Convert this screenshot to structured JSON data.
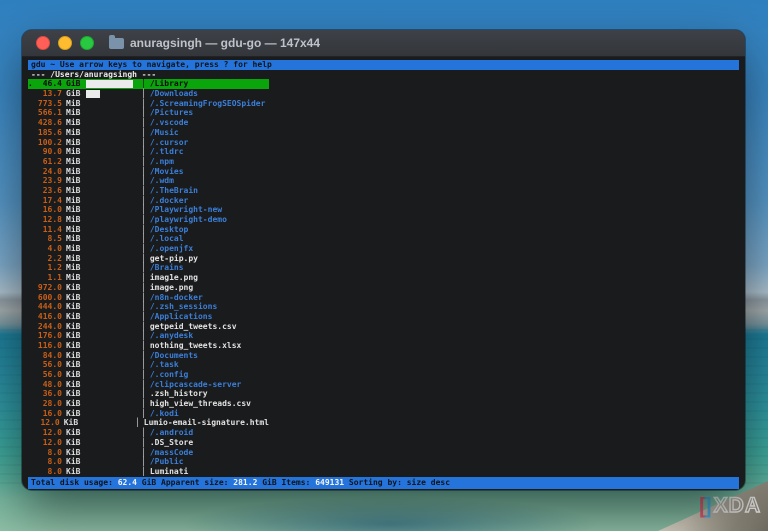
{
  "colors": {
    "accent_blue": "#2474dc",
    "selection_green": "#0aa50a",
    "size_orange": "#c95f16",
    "dir_blue": "#3b7fd9",
    "file_white": "#e2e2e2"
  },
  "window": {
    "title": "anuragsingh — gdu-go — 147x44",
    "header": "gdu ~ Use arrow keys to navigate, press ? for help",
    "path_line": "--- /Users/anuragsingh ---",
    "items": [
      {
        "prefix": ".",
        "size": "46.4",
        "unit": "GiB",
        "bar": 0.97,
        "name": "/Library",
        "type": "dir",
        "selected": true
      },
      {
        "prefix": "",
        "size": "13.7",
        "unit": "GiB",
        "bar": 0.295,
        "name": "/Downloads",
        "type": "dir",
        "selected": false
      },
      {
        "prefix": "",
        "size": "773.5",
        "unit": "MiB",
        "bar": 0,
        "name": "/.ScreamingFrogSEOSpider",
        "type": "dir",
        "selected": false
      },
      {
        "prefix": "",
        "size": "566.1",
        "unit": "MiB",
        "bar": 0,
        "name": "/Pictures",
        "type": "dir",
        "selected": false
      },
      {
        "prefix": "",
        "size": "428.6",
        "unit": "MiB",
        "bar": 0,
        "name": "/.vscode",
        "type": "dir",
        "selected": false
      },
      {
        "prefix": "",
        "size": "185.6",
        "unit": "MiB",
        "bar": 0,
        "name": "/Music",
        "type": "dir",
        "selected": false
      },
      {
        "prefix": "",
        "size": "100.2",
        "unit": "MiB",
        "bar": 0,
        "name": "/.cursor",
        "type": "dir",
        "selected": false
      },
      {
        "prefix": "",
        "size": "90.0",
        "unit": "MiB",
        "bar": 0,
        "name": "/.tldrc",
        "type": "dir",
        "selected": false
      },
      {
        "prefix": "",
        "size": "61.2",
        "unit": "MiB",
        "bar": 0,
        "name": "/.npm",
        "type": "dir",
        "selected": false
      },
      {
        "prefix": "",
        "size": "24.0",
        "unit": "MiB",
        "bar": 0,
        "name": "/Movies",
        "type": "dir",
        "selected": false
      },
      {
        "prefix": "",
        "size": "23.9",
        "unit": "MiB",
        "bar": 0,
        "name": "/.wdm",
        "type": "dir",
        "selected": false
      },
      {
        "prefix": "",
        "size": "23.6",
        "unit": "MiB",
        "bar": 0,
        "name": "/.TheBrain",
        "type": "dir",
        "selected": false
      },
      {
        "prefix": "",
        "size": "17.4",
        "unit": "MiB",
        "bar": 0,
        "name": "/.docker",
        "type": "dir",
        "selected": false
      },
      {
        "prefix": "",
        "size": "16.0",
        "unit": "MiB",
        "bar": 0,
        "name": "/Playwright-new",
        "type": "dir",
        "selected": false
      },
      {
        "prefix": "",
        "size": "12.8",
        "unit": "MiB",
        "bar": 0,
        "name": "/playwright-demo",
        "type": "dir",
        "selected": false
      },
      {
        "prefix": "",
        "size": "11.4",
        "unit": "MiB",
        "bar": 0,
        "name": "/Desktop",
        "type": "dir",
        "selected": false
      },
      {
        "prefix": "",
        "size": "8.5",
        "unit": "MiB",
        "bar": 0,
        "name": "/.local",
        "type": "dir",
        "selected": false
      },
      {
        "prefix": "",
        "size": "4.0",
        "unit": "MiB",
        "bar": 0,
        "name": "/.openjfx",
        "type": "dir",
        "selected": false
      },
      {
        "prefix": "",
        "size": "2.2",
        "unit": "MiB",
        "bar": 0,
        "name": "get-pip.py",
        "type": "file",
        "selected": false
      },
      {
        "prefix": "",
        "size": "1.2",
        "unit": "MiB",
        "bar": 0,
        "name": "/Brains",
        "type": "dir",
        "selected": false
      },
      {
        "prefix": "",
        "size": "1.1",
        "unit": "MiB",
        "bar": 0,
        "name": "imag1e.png",
        "type": "file",
        "selected": false
      },
      {
        "prefix": "",
        "size": "972.0",
        "unit": "KiB",
        "bar": 0,
        "name": "image.png",
        "type": "file",
        "selected": false
      },
      {
        "prefix": "",
        "size": "600.0",
        "unit": "KiB",
        "bar": 0,
        "name": "/n8n-docker",
        "type": "dir",
        "selected": false
      },
      {
        "prefix": "",
        "size": "444.0",
        "unit": "KiB",
        "bar": 0,
        "name": "/.zsh_sessions",
        "type": "dir",
        "selected": false
      },
      {
        "prefix": "",
        "size": "416.0",
        "unit": "KiB",
        "bar": 0,
        "name": "/Applications",
        "type": "dir",
        "selected": false
      },
      {
        "prefix": "",
        "size": "244.0",
        "unit": "KiB",
        "bar": 0,
        "name": "getpeid_tweets.csv",
        "type": "file",
        "selected": false
      },
      {
        "prefix": "",
        "size": "176.0",
        "unit": "KiB",
        "bar": 0,
        "name": "/.anydesk",
        "type": "dir",
        "selected": false
      },
      {
        "prefix": "",
        "size": "116.0",
        "unit": "KiB",
        "bar": 0,
        "name": "nothing_tweets.xlsx",
        "type": "file",
        "selected": false
      },
      {
        "prefix": "",
        "size": "84.0",
        "unit": "KiB",
        "bar": 0,
        "name": "/Documents",
        "type": "dir",
        "selected": false
      },
      {
        "prefix": "",
        "size": "56.0",
        "unit": "KiB",
        "bar": 0,
        "name": "/.task",
        "type": "dir",
        "selected": false
      },
      {
        "prefix": "",
        "size": "56.0",
        "unit": "KiB",
        "bar": 0,
        "name": "/.config",
        "type": "dir",
        "selected": false
      },
      {
        "prefix": "",
        "size": "48.0",
        "unit": "KiB",
        "bar": 0,
        "name": "/clipcascade-server",
        "type": "dir",
        "selected": false
      },
      {
        "prefix": "",
        "size": "36.0",
        "unit": "KiB",
        "bar": 0,
        "name": ".zsh_history",
        "type": "file",
        "selected": false
      },
      {
        "prefix": "",
        "size": "28.0",
        "unit": "KiB",
        "bar": 0,
        "name": "high_view_threads.csv",
        "type": "file",
        "selected": false
      },
      {
        "prefix": "",
        "size": "16.0",
        "unit": "KiB",
        "bar": 0,
        "name": "/.kodi",
        "type": "dir",
        "selected": false
      },
      {
        "prefix": "",
        "size": "12.0",
        "unit": "KiB",
        "bar": 0,
        "name": "Lumio-email-signature.html",
        "type": "file",
        "selected": false
      },
      {
        "prefix": "",
        "size": "12.0",
        "unit": "KiB",
        "bar": 0,
        "name": "/.android",
        "type": "dir",
        "selected": false
      },
      {
        "prefix": "",
        "size": "12.0",
        "unit": "KiB",
        "bar": 0,
        "name": ".DS_Store",
        "type": "file",
        "selected": false
      },
      {
        "prefix": "",
        "size": "8.0",
        "unit": "KiB",
        "bar": 0,
        "name": "/massCode",
        "type": "dir",
        "selected": false
      },
      {
        "prefix": "",
        "size": "8.0",
        "unit": "KiB",
        "bar": 0,
        "name": "/Public",
        "type": "dir",
        "selected": false
      },
      {
        "prefix": "",
        "size": "8.0",
        "unit": "KiB",
        "bar": 0,
        "name": "Luminati",
        "type": "file",
        "selected": false
      }
    ],
    "footer_segments": [
      {
        "text": "Total disk usage: ",
        "em": false
      },
      {
        "text": "62.4",
        "em": true
      },
      {
        "text": " GiB Apparent size: ",
        "em": false
      },
      {
        "text": "281.2",
        "em": true
      },
      {
        "text": " GiB Items: ",
        "em": false
      },
      {
        "text": "649131",
        "em": true
      },
      {
        "text": " Sorting by: size desc",
        "em": false
      }
    ]
  },
  "watermark": {
    "bracket_left": "[",
    "bracket_right": "]",
    "text": "XDA"
  }
}
